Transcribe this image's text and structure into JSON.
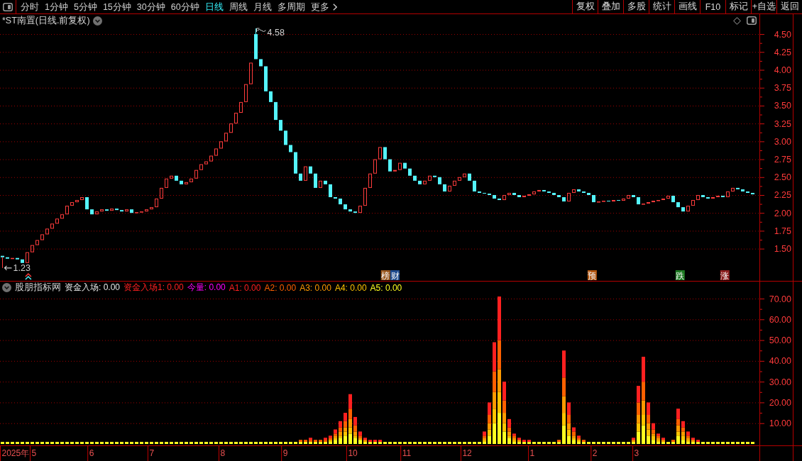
{
  "toolbar": {
    "periods": [
      {
        "label": "分时",
        "selected": false
      },
      {
        "label": "1分钟",
        "selected": false
      },
      {
        "label": "5分钟",
        "selected": false
      },
      {
        "label": "15分钟",
        "selected": false
      },
      {
        "label": "30分钟",
        "selected": false
      },
      {
        "label": "60分钟",
        "selected": false
      },
      {
        "label": "日线",
        "selected": true
      },
      {
        "label": "周线",
        "selected": false
      },
      {
        "label": "月线",
        "selected": false
      },
      {
        "label": "多周期",
        "selected": false
      }
    ],
    "more": "更多",
    "buttons": [
      "复权",
      "叠加",
      "多股",
      "统计",
      "画线",
      "F10",
      "标记",
      "+自选",
      "返回"
    ]
  },
  "price_panel": {
    "title": "*ST南置(日线.前复权)",
    "axis_labels": [
      "4.50",
      "4.25",
      "4.00",
      "3.75",
      "3.50",
      "3.25",
      "3.00",
      "2.75",
      "2.50",
      "2.25",
      "2.00",
      "1.75",
      "1.50"
    ],
    "high_label": "4.58",
    "low_label": "1.23",
    "event_tags": [
      {
        "text": "榜",
        "color": "#9c5a22"
      },
      {
        "text": "财",
        "color": "#1f4b8e"
      },
      {
        "text": "预",
        "color": "#b3560f"
      },
      {
        "text": "跌",
        "color": "#1d7a22"
      },
      {
        "text": "涨",
        "color": "#8c1f1f"
      }
    ]
  },
  "indicator_panel": {
    "name": "股朋指标网",
    "legend": [
      {
        "text": "资金入场: 0.00",
        "color": "#e6e6e6"
      },
      {
        "text": "资金入场1: 0.00",
        "color": "#ff2020"
      },
      {
        "text": "今量: 0.00",
        "color": "#ff00ff"
      },
      {
        "text": "A1: 0.00",
        "color": "#ff2020"
      },
      {
        "text": "A2: 0.00",
        "color": "#ff6000"
      },
      {
        "text": "A3: 0.00",
        "color": "#ff9a00"
      },
      {
        "text": "A4: 0.00",
        "color": "#ffc400"
      },
      {
        "text": "A5: 0.00",
        "color": "#ffff20"
      }
    ],
    "chart_data": {
      "type": "bar",
      "stacked": true,
      "grid": true,
      "ylim": [
        0,
        72.4
      ],
      "yticks": [
        {
          "value": 10,
          "label": "10.00"
        },
        {
          "value": 20,
          "label": "20.00"
        },
        {
          "value": 30,
          "label": "30.00"
        },
        {
          "value": 40,
          "label": "40.00"
        },
        {
          "value": 50,
          "label": "50.00"
        },
        {
          "value": 60,
          "label": "60.00"
        },
        {
          "value": 70,
          "label": "70.00"
        }
      ],
      "series": [
        {
          "color": "#ffff20",
          "values": [
            1,
            1,
            1,
            1,
            1,
            1,
            1,
            1,
            1,
            1,
            1,
            1,
            1,
            1,
            1,
            1,
            1,
            1,
            1,
            1,
            1,
            1,
            1,
            1,
            1,
            1,
            1,
            1,
            1,
            1,
            1,
            1,
            1,
            1,
            1,
            1,
            1,
            1,
            1,
            1,
            1,
            1,
            1,
            1,
            1,
            1,
            1,
            1,
            1,
            1,
            1,
            1,
            1,
            1,
            1,
            1,
            1,
            1,
            1,
            1,
            1,
            1,
            1,
            1,
            1,
            1,
            1,
            2,
            3,
            4,
            5,
            3,
            2,
            1,
            1,
            1,
            1,
            1,
            1,
            1,
            1,
            1,
            1,
            1,
            1,
            1,
            1,
            1,
            1,
            1,
            1,
            1,
            1,
            1,
            1,
            1,
            1,
            1,
            4,
            10,
            15,
            6,
            3,
            1,
            1,
            1,
            1,
            1,
            1,
            1,
            1,
            1,
            1,
            9,
            4,
            2,
            1,
            1,
            1,
            1,
            1,
            1,
            1,
            1,
            1,
            1,
            1,
            1,
            6,
            9,
            4,
            2,
            1,
            1,
            1,
            1,
            4,
            2,
            1,
            1,
            1,
            1,
            1,
            1,
            1,
            1,
            1,
            1,
            1,
            1,
            1,
            1
          ]
        },
        {
          "color": "#ffc400",
          "values": [
            0,
            0,
            0,
            0,
            0,
            0,
            0,
            0,
            0,
            0,
            0,
            0,
            0,
            0,
            0,
            0,
            0,
            0,
            0,
            0,
            0,
            0,
            0,
            0,
            0,
            0,
            0,
            0,
            0,
            0,
            0,
            0,
            0,
            0,
            0,
            0,
            0,
            0,
            0,
            0,
            0,
            0,
            0,
            0,
            0,
            0,
            0,
            0,
            0,
            0,
            0,
            0,
            0,
            0,
            0,
            0,
            0,
            0,
            0,
            0,
            0,
            0,
            0,
            0,
            0,
            0,
            1,
            1,
            1,
            2,
            3,
            1,
            0,
            0,
            0,
            0,
            0,
            0,
            0,
            0,
            0,
            0,
            0,
            0,
            0,
            0,
            0,
            0,
            0,
            0,
            0,
            0,
            0,
            0,
            0,
            0,
            0,
            1,
            3,
            7,
            10,
            4,
            1,
            1,
            0,
            0,
            0,
            0,
            0,
            0,
            0,
            0,
            0,
            6,
            3,
            1,
            1,
            0,
            0,
            0,
            0,
            0,
            0,
            0,
            0,
            0,
            0,
            0,
            4,
            5,
            3,
            2,
            1,
            0,
            0,
            0,
            2,
            2,
            1,
            0,
            0,
            0,
            0,
            0,
            0,
            0,
            0,
            0,
            0,
            0,
            0,
            0
          ]
        },
        {
          "color": "#ff9a00",
          "values": [
            0,
            0,
            0,
            0,
            0,
            0,
            0,
            0,
            0,
            0,
            0,
            0,
            0,
            0,
            0,
            0,
            0,
            0,
            0,
            0,
            0,
            0,
            0,
            0,
            0,
            0,
            0,
            0,
            0,
            0,
            0,
            0,
            0,
            0,
            0,
            0,
            0,
            0,
            0,
            0,
            0,
            0,
            0,
            0,
            0,
            0,
            0,
            0,
            0,
            0,
            0,
            0,
            0,
            0,
            0,
            0,
            0,
            0,
            0,
            0,
            0,
            0,
            0,
            0,
            0,
            0,
            0,
            1,
            2,
            2,
            4,
            2,
            1,
            1,
            0,
            0,
            0,
            0,
            0,
            0,
            0,
            0,
            0,
            0,
            0,
            0,
            0,
            0,
            0,
            0,
            0,
            0,
            0,
            0,
            0,
            0,
            0,
            1,
            3,
            8,
            11,
            5,
            2,
            1,
            1,
            0,
            0,
            0,
            0,
            0,
            0,
            0,
            0,
            8,
            3,
            1,
            0,
            0,
            0,
            0,
            0,
            0,
            0,
            0,
            0,
            0,
            0,
            1,
            4,
            7,
            3,
            1,
            1,
            1,
            0,
            0,
            3,
            2,
            1,
            1,
            0,
            0,
            0,
            0,
            0,
            0,
            0,
            0,
            0,
            0,
            0,
            0
          ]
        },
        {
          "color": "#ff6000",
          "values": [
            0,
            0,
            0,
            0,
            0,
            0,
            0,
            0,
            0,
            0,
            0,
            0,
            0,
            0,
            0,
            0,
            0,
            0,
            0,
            0,
            0,
            0,
            0,
            0,
            0,
            0,
            0,
            0,
            0,
            0,
            0,
            0,
            0,
            0,
            0,
            0,
            0,
            0,
            0,
            0,
            0,
            0,
            0,
            0,
            0,
            0,
            0,
            0,
            0,
            0,
            0,
            0,
            0,
            0,
            0,
            0,
            0,
            0,
            0,
            0,
            1,
            1,
            1,
            1,
            1,
            1,
            1,
            1,
            2,
            3,
            5,
            3,
            1,
            0,
            0,
            0,
            0,
            0,
            0,
            0,
            0,
            0,
            0,
            0,
            0,
            0,
            0,
            0,
            0,
            0,
            0,
            0,
            0,
            0,
            0,
            0,
            0,
            1,
            4,
            10,
            14,
            6,
            2,
            1,
            0,
            0,
            0,
            0,
            0,
            0,
            0,
            0,
            1,
            9,
            4,
            2,
            1,
            1,
            0,
            0,
            0,
            0,
            0,
            0,
            0,
            0,
            0,
            0,
            6,
            9,
            4,
            2,
            1,
            0,
            0,
            1,
            3,
            2,
            1,
            0,
            0,
            0,
            0,
            0,
            0,
            0,
            0,
            0,
            0,
            0,
            0,
            0
          ]
        },
        {
          "color": "#ff2020",
          "values": [
            0,
            0,
            0,
            0,
            0,
            0,
            0,
            0,
            0,
            0,
            0,
            0,
            0,
            0,
            0,
            0,
            0,
            0,
            0,
            0,
            0,
            0,
            0,
            0,
            0,
            0,
            0,
            0,
            0,
            0,
            0,
            0,
            0,
            0,
            0,
            0,
            0,
            0,
            0,
            0,
            0,
            0,
            0,
            0,
            0,
            0,
            0,
            0,
            0,
            0,
            0,
            0,
            0,
            0,
            0,
            0,
            0,
            0,
            0,
            0,
            0,
            0,
            1,
            0,
            0,
            1,
            1,
            2,
            3,
            4,
            7,
            4,
            2,
            1,
            1,
            1,
            1,
            0,
            0,
            0,
            0,
            0,
            0,
            0,
            0,
            0,
            0,
            0,
            0,
            0,
            0,
            0,
            0,
            0,
            0,
            0,
            0,
            2,
            6,
            14,
            21,
            9,
            4,
            1,
            1,
            1,
            1,
            0,
            0,
            0,
            0,
            0,
            0,
            13,
            6,
            2,
            1,
            0,
            0,
            0,
            0,
            0,
            0,
            0,
            0,
            0,
            0,
            1,
            8,
            12,
            6,
            3,
            1,
            1,
            0,
            0,
            5,
            3,
            2,
            1,
            1,
            0,
            0,
            0,
            0,
            0,
            0,
            0,
            0,
            0,
            0,
            0
          ]
        }
      ]
    },
    "time_axis": [
      "2025年",
      "5",
      "6",
      "7",
      "8",
      "9",
      "10",
      "11",
      "12",
      "1",
      "2",
      "3"
    ]
  }
}
